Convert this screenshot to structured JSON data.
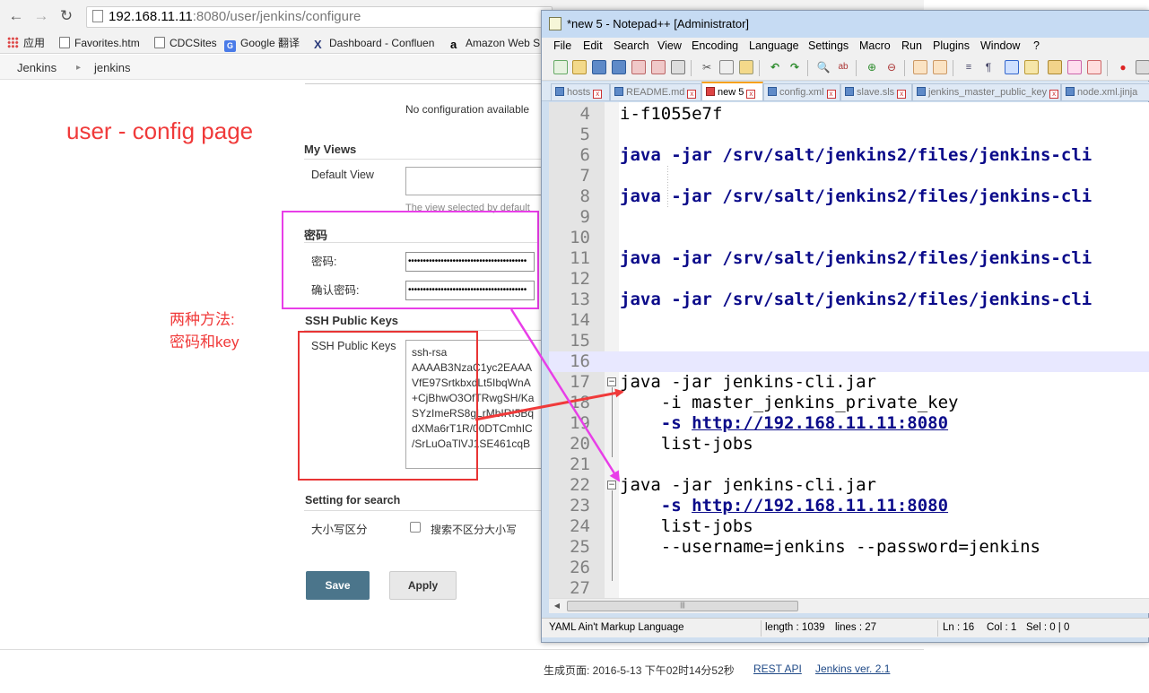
{
  "browser": {
    "url_host": "192.168.11.11",
    "url_rest": ":8080/user/jenkins/configure",
    "back_icon": "arrow-left-icon",
    "forward_icon": "arrow-right-icon",
    "reload_icon": "reload-icon",
    "bookmarks": [
      {
        "label": "应用",
        "icon": "apps-grid-icon"
      },
      {
        "label": "Favorites.htm",
        "icon": "page-icon"
      },
      {
        "label": "CDCSites",
        "icon": "page-icon"
      },
      {
        "label": "Google 翻译",
        "icon": "google-translate-icon"
      },
      {
        "label": "Dashboard - Confluen",
        "icon": "confluence-icon"
      },
      {
        "label": "Amazon Web S",
        "icon": "amazon-icon"
      }
    ]
  },
  "jenkins": {
    "breadcrumb": [
      "Jenkins",
      "jenkins"
    ],
    "no_config_note": "No configuration available",
    "my_views_title": "My Views",
    "default_view_label": "Default View",
    "default_view_hint": "The view selected by default",
    "password_section_title": "密码",
    "password_label": "密码:",
    "confirm_password_label": "确认密码:",
    "password_mask": "••••••••••••••••••••••••••••••••••••••••",
    "ssh_section_title": "SSH Public Keys",
    "ssh_field_label": "SSH Public Keys",
    "ssh_key_lines": [
      "ssh-rsa",
      "AAAAB3NzaC1yc2EAAA",
      "VfE97SrtkbxdLt5IbqWnA",
      "+CjBhwO3OfTRwgSH/Ka",
      "SYzImeRS8gLrMbIRI5Bq",
      "dXMa6rT1R/00DTCmhIC",
      "/SrLuOaTlVJ1SE461cqB"
    ],
    "search_section_title": "Setting for search",
    "case_label": "大小写区分",
    "case_checkbox_label": "搜索不区分大小写",
    "case_insensitive_checked": false,
    "save_label": "Save",
    "apply_label": "Apply",
    "footer_generated": "生成页面: 2016-5-13 下午02时14分52秒",
    "footer_rest_api": "REST API",
    "footer_version": "Jenkins ver. 2.1"
  },
  "annotations": {
    "title": "user - config page",
    "methods_line1": "两种方法:",
    "methods_line2": "密码和key",
    "colors": {
      "red": "#f03a3a",
      "magenta": "#e83ee8"
    }
  },
  "npp": {
    "title": "*new 5 - Notepad++ [Administrator]",
    "menu": [
      "File",
      "Edit",
      "Search",
      "View",
      "Encoding",
      "Language",
      "Settings",
      "Macro",
      "Run",
      "Plugins",
      "Window",
      "?"
    ],
    "tabs": [
      {
        "label": "hosts",
        "active": false
      },
      {
        "label": "README.md",
        "active": false
      },
      {
        "label": "new 5",
        "active": true
      },
      {
        "label": "config.xml",
        "active": false
      },
      {
        "label": "slave.sls",
        "active": false
      },
      {
        "label": "jenkins_master_public_key",
        "active": false
      },
      {
        "label": "node.xml.jinja",
        "active": false
      }
    ],
    "lines": [
      {
        "n": "4",
        "text": "i-f1055e7f"
      },
      {
        "n": "5",
        "text": ""
      },
      {
        "n": "6",
        "kw": "java -jar /srv/salt/jenkins2/files/jenkins-cli"
      },
      {
        "n": "7",
        "text": ""
      },
      {
        "n": "8",
        "kw": "java -jar /srv/salt/jenkins2/files/jenkins-cli"
      },
      {
        "n": "9",
        "text": ""
      },
      {
        "n": "10",
        "text": ""
      },
      {
        "n": "11",
        "kw": "java -jar /srv/salt/jenkins2/files/jenkins-cli"
      },
      {
        "n": "12",
        "text": ""
      },
      {
        "n": "13",
        "kw": "java -jar /srv/salt/jenkins2/files/jenkins-cli"
      },
      {
        "n": "14",
        "text": ""
      },
      {
        "n": "15",
        "text": ""
      },
      {
        "n": "16",
        "text": ""
      },
      {
        "n": "17",
        "text": "java -jar jenkins-cli.jar"
      },
      {
        "n": "18",
        "text": "    -i master_jenkins_private_key"
      },
      {
        "n": "19",
        "kwpart": "    -s ",
        "link": "http://192.168.11.11:8080"
      },
      {
        "n": "20",
        "text": "    list-jobs"
      },
      {
        "n": "21",
        "text": ""
      },
      {
        "n": "22",
        "text": "java -jar jenkins-cli.jar"
      },
      {
        "n": "23",
        "kwpart": "    -s ",
        "link": "http://192.168.11.11:8080"
      },
      {
        "n": "24",
        "text": "    list-jobs"
      },
      {
        "n": "25",
        "text": "    --username=jenkins --password=jenkins"
      },
      {
        "n": "26",
        "text": ""
      },
      {
        "n": "27",
        "text": ""
      }
    ],
    "current_line": "16",
    "status": {
      "language": "YAML Ain't Markup Language",
      "length": "length : 1039",
      "lines": "lines : 27",
      "ln": "Ln : 16",
      "col": "Col : 1",
      "sel": "Sel : 0 | 0"
    }
  }
}
